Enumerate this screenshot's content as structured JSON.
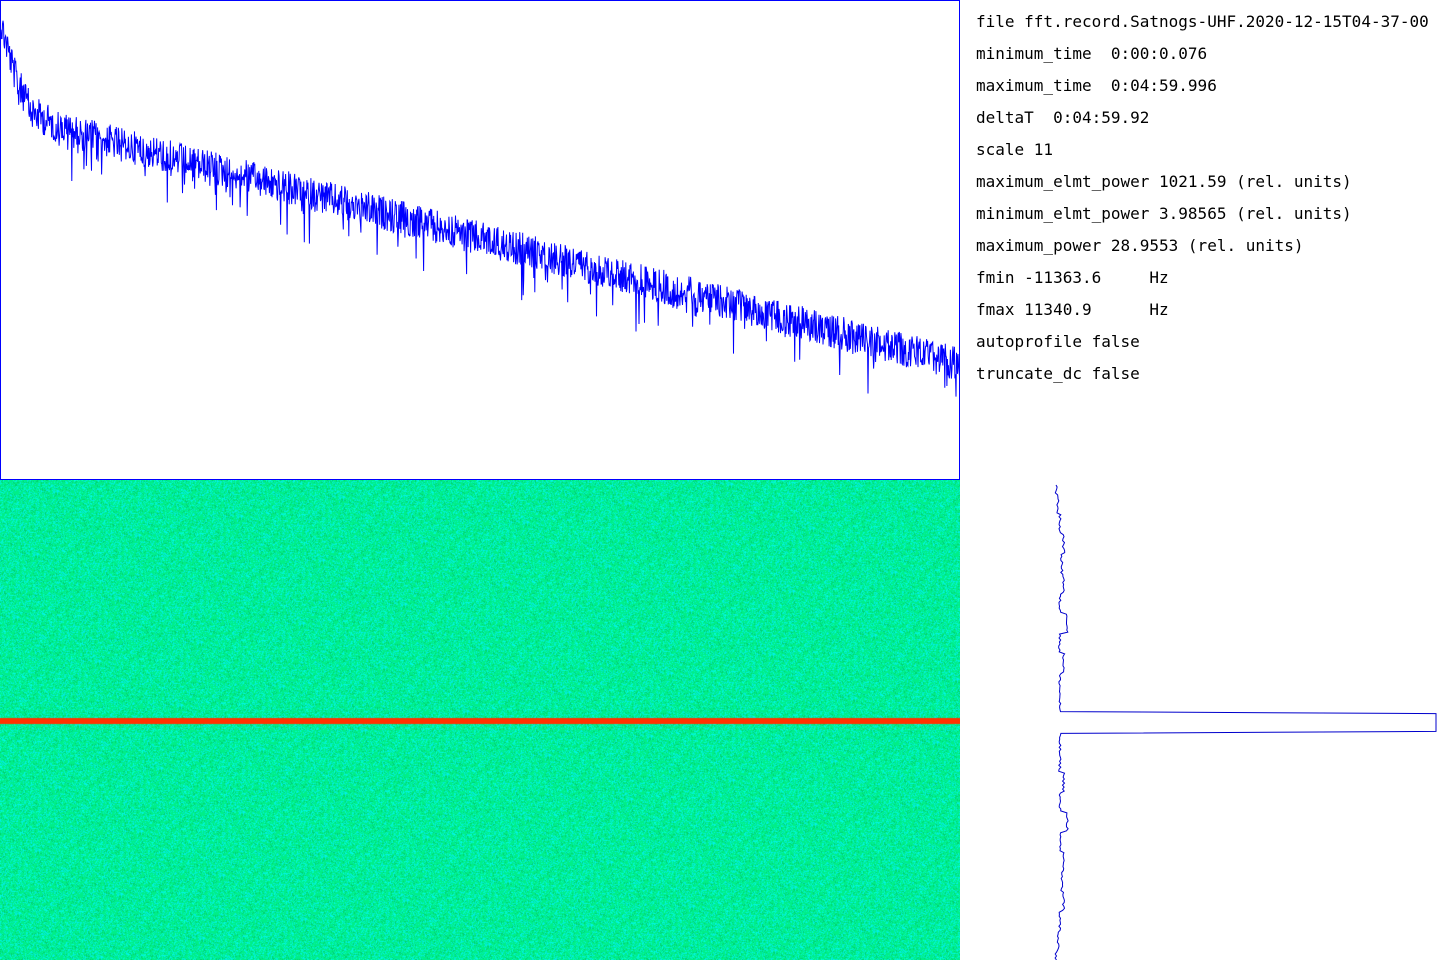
{
  "info": {
    "lines": [
      "file fft.record.Satnogs-UHF.2020-12-15T04-37-00",
      "minimum_time  0:00:0.076",
      "maximum_time  0:04:59.996",
      "deltaT  0:04:59.92",
      "scale 11",
      "maximum_elmt_power 1021.59 (rel. units)",
      "minimum_elmt_power 3.98565 (rel. units)",
      "maximum_power 28.9553 (rel. units)",
      "fmin -11363.6     Hz",
      "fmax 11340.9      Hz",
      "autoprofile false",
      "truncate_dc false"
    ]
  },
  "colors": {
    "spectrum_line": "#0000ff",
    "spectrum_border": "#0000ff",
    "waterfall_base": "#00ee88",
    "waterfall_speckle": "#00ffcc",
    "signal_band": "#ff3300",
    "profile_line": "#0000cc"
  },
  "chart_data": [
    {
      "type": "line",
      "title": "",
      "xlabel": "",
      "ylabel": "",
      "series": [
        {
          "values": [
            1.0,
            0.86,
            0.78,
            0.76,
            0.74,
            0.73,
            0.72,
            0.71,
            0.7,
            0.69,
            0.68,
            0.67,
            0.66,
            0.65,
            0.64,
            0.63,
            0.62,
            0.61,
            0.6,
            0.59,
            0.58,
            0.57,
            0.56,
            0.55,
            0.54,
            0.53,
            0.52,
            0.51,
            0.5,
            0.49,
            0.48,
            0.47,
            0.46,
            0.45,
            0.44,
            0.43,
            0.42,
            0.41,
            0.4,
            0.39,
            0.38,
            0.37,
            0.36,
            0.35,
            0.34,
            0.33,
            0.32,
            0.31,
            0.3,
            0.29,
            0.28,
            0.27,
            0.26,
            0.25,
            0.24,
            0.23,
            0.22,
            0.21,
            0.2,
            0.19,
            0.18
          ]
        }
      ]
    },
    {
      "type": "line",
      "title": "",
      "series": [
        {
          "values": [
            0.0,
            0.005,
            0.01,
            0.02,
            0.015,
            0.02,
            0.01,
            0.03,
            0.01,
            0.02,
            0.01,
            0.01,
            1.0,
            0.01,
            0.01,
            0.02,
            0.01,
            0.03,
            0.01,
            0.02,
            0.015,
            0.02,
            0.01,
            0.005,
            0.0
          ]
        }
      ]
    }
  ]
}
